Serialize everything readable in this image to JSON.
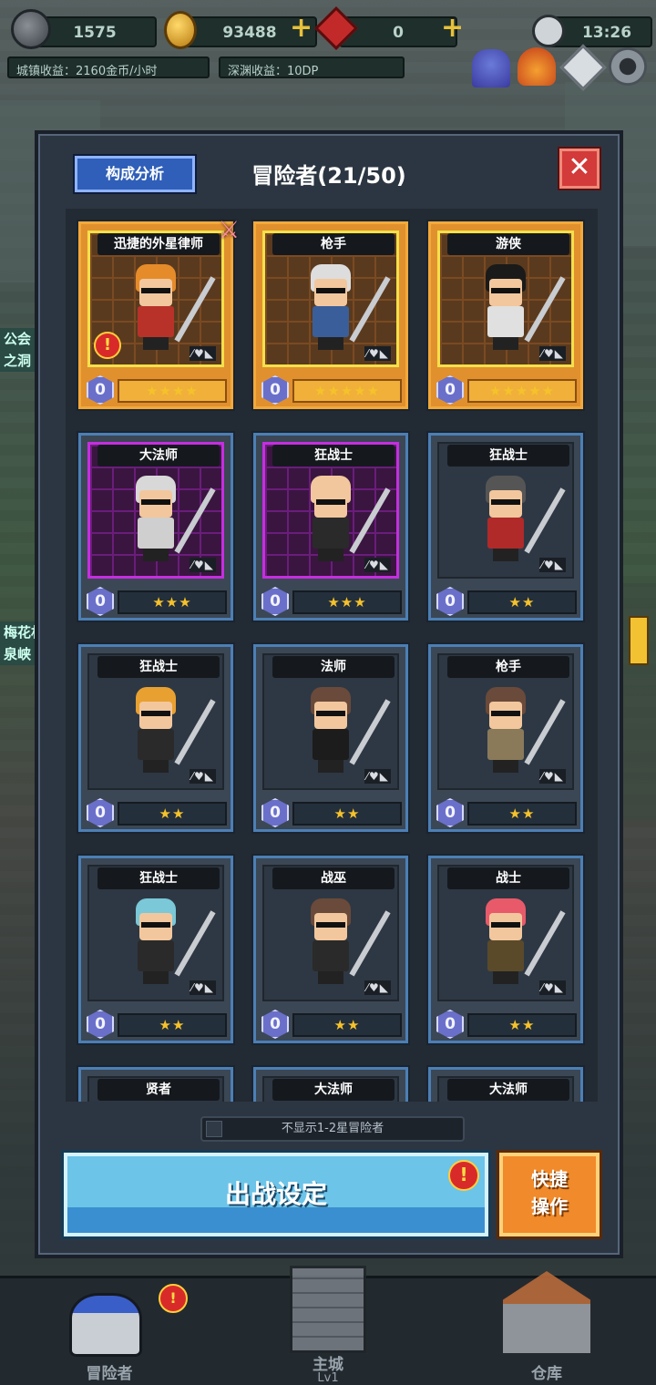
{
  "topbar": {
    "exp": "1575",
    "gold": "93488",
    "gems": "0",
    "plus": "+",
    "time": "13:26",
    "town_income": "城镇收益：2160金币/小时",
    "abyss_income": "深渊收益：10DP"
  },
  "side_labels": [
    "公会",
    "之洞",
    "梅花村",
    "泉峡"
  ],
  "panel": {
    "analyze_label": "构成分析",
    "title": "冒险者(21/50)",
    "close_label": "✕",
    "toggle_label": "不显示1-2星冒险者",
    "deploy_label": "出战设定",
    "quick_label_1": "快捷",
    "quick_label_2": "操作",
    "alert_mark": "!"
  },
  "equip_marks": "⁄♥◣",
  "cards": [
    {
      "name": "迅捷的外星律师",
      "level": "0",
      "stars": "★★★★",
      "rarity": "gold",
      "hair": "#e58b2a",
      "outfit": "#b8322a"
    },
    {
      "name": "枪手",
      "level": "0",
      "stars": "★★★★★",
      "rarity": "gold",
      "hair": "#ddd",
      "outfit": "#3a5e9a"
    },
    {
      "name": "游侠",
      "level": "0",
      "stars": "★★★★★",
      "rarity": "gold",
      "hair": "#1a1a1a",
      "outfit": "#e0e0e0"
    },
    {
      "name": "大法师",
      "level": "0",
      "stars": "★★★",
      "rarity": "purple",
      "hair": "#d8d8d8",
      "outfit": "#cfcfcf"
    },
    {
      "name": "狂战士",
      "level": "0",
      "stars": "★★★",
      "rarity": "purple",
      "hair": "#f2c79d",
      "outfit": "#2a2a2a"
    },
    {
      "name": "狂战士",
      "level": "0",
      "stars": "★★",
      "rarity": "blue",
      "hair": "#555",
      "outfit": "#b02a2a"
    },
    {
      "name": "狂战士",
      "level": "0",
      "stars": "★★",
      "rarity": "blue",
      "hair": "#e8a030",
      "outfit": "#2a2a2a"
    },
    {
      "name": "法师",
      "level": "0",
      "stars": "★★",
      "rarity": "blue",
      "hair": "#6a4a3a",
      "outfit": "#1c1c1c"
    },
    {
      "name": "枪手",
      "level": "0",
      "stars": "★★",
      "rarity": "blue",
      "hair": "#6a4a3a",
      "outfit": "#8a7a5a"
    },
    {
      "name": "狂战士",
      "level": "0",
      "stars": "★★",
      "rarity": "blue",
      "hair": "#7ac8d8",
      "outfit": "#2a2a2a"
    },
    {
      "name": "战巫",
      "level": "0",
      "stars": "★★",
      "rarity": "blue",
      "hair": "#6a4a3a",
      "outfit": "#2a2a2a"
    },
    {
      "name": "战士",
      "level": "0",
      "stars": "★★",
      "rarity": "blue",
      "hair": "#e85a6a",
      "outfit": "#5a4a2a"
    },
    {
      "name": "贤者",
      "level": "",
      "stars": "",
      "rarity": "blue",
      "hair": "",
      "outfit": ""
    },
    {
      "name": "大法师",
      "level": "",
      "stars": "",
      "rarity": "blue",
      "hair": "",
      "outfit": ""
    },
    {
      "name": "大法师",
      "level": "",
      "stars": "",
      "rarity": "blue",
      "hair": "",
      "outfit": ""
    }
  ],
  "nav": {
    "adventurer": "冒险者",
    "main_city": "主城",
    "main_city_level": "Lv1",
    "warehouse": "仓库"
  },
  "icons": [
    "exp-orb-icon",
    "gold-coin-icon",
    "red-gem-icon",
    "clock-icon",
    "party-icon",
    "fire-icon",
    "compass-icon",
    "gear-icon",
    "knight-helmet-icon",
    "castle-icon",
    "warehouse-icon"
  ]
}
